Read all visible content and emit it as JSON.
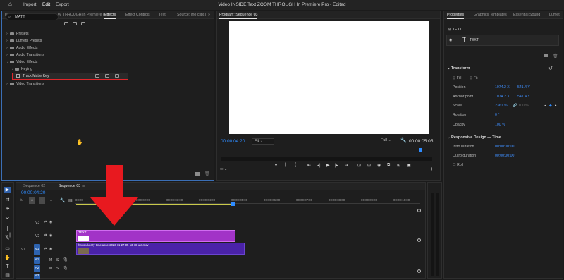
{
  "app": {
    "menus": [
      "Import",
      "Edit",
      "Export"
    ],
    "active_menu": "Edit",
    "title": "Video INSIDE Text ZOOM THROUGH In Premiere Pro - Edited"
  },
  "effects_panel": {
    "tabs": [
      "Project: Video INSIDE Text ZOOM THROUGH In Premiere Pro",
      "Effects",
      "Effect Controls",
      "Text",
      "Source: (no clips)"
    ],
    "active_tab": "Effects",
    "search_value": "MATT",
    "tree": [
      {
        "label": "Presets",
        "level": 0
      },
      {
        "label": "Lumetri Presets",
        "level": 0
      },
      {
        "label": "Audio Effects",
        "level": 0
      },
      {
        "label": "Audio Transitions",
        "level": 0
      },
      {
        "label": "Video Effects",
        "level": 0
      },
      {
        "label": "Keying",
        "level": 1
      },
      {
        "label": "Track Matte Key",
        "level": 2
      },
      {
        "label": "Video Transitions",
        "level": 0
      }
    ]
  },
  "program_monitor": {
    "tab": "Program: Sequence 03",
    "timecode": "00:00:04:20",
    "fit": "Fit",
    "quality": "Full",
    "duration": "00:00:05:05"
  },
  "properties_panel": {
    "tabs": [
      "Properties",
      "Graphics Templates",
      "Essential Sound",
      "Lumet"
    ],
    "active_tab": "Properties",
    "selection_label": "TEXT",
    "layer_name": "TEXT",
    "transform_title": "Transform",
    "fill_label": "Fill",
    "fit_label": "Fit",
    "position_label": "Position",
    "position_x": "1074.2 X",
    "position_y": "541.4 Y",
    "anchor_label": "Anchor point",
    "anchor_x": "1074.2 X",
    "anchor_y": "541.4 Y",
    "scale_label": "Scale",
    "scale_value": "2361 %",
    "scale_secondary": "100 %",
    "rotation_label": "Rotation",
    "rotation_value": "0 °",
    "opacity_label": "Opacity",
    "opacity_value": "100 %",
    "responsive_title": "Responsive Design — Time",
    "intro_label": "Intro duration",
    "intro_value": "00:00:00:00",
    "outro_label": "Outro duration",
    "outro_value": "00:00:00:00",
    "roll_label": "Roll"
  },
  "timeline": {
    "tabs": [
      "Sequence 02",
      "Sequence 03"
    ],
    "active_tab": "Sequence 03",
    "timecode": "00:00:04:20",
    "ruler": [
      "00:00",
      "00:00:01:00",
      "00:00:02:00",
      "00:00:03:00",
      "00:00:04:00",
      "00:00:05:00",
      "00:00:06:00",
      "00:00:07:00",
      "00:00:08:00",
      "00:00:09:00",
      "00:00:10:00"
    ],
    "tracks": [
      "V3",
      "V2",
      "V1",
      "A1",
      "A2",
      "A3"
    ],
    "clip_text": "TEXT",
    "clip_video": "honolulu-city-timelapse-2023-11-27-05-13-18-utc.mov"
  },
  "colors": {
    "accent_blue": "#2f8cff",
    "clip_purple": "#a233c7",
    "clip_violet": "#4a22a8",
    "highlight_red": "#e0262a",
    "arrow_red": "#e8191f"
  }
}
